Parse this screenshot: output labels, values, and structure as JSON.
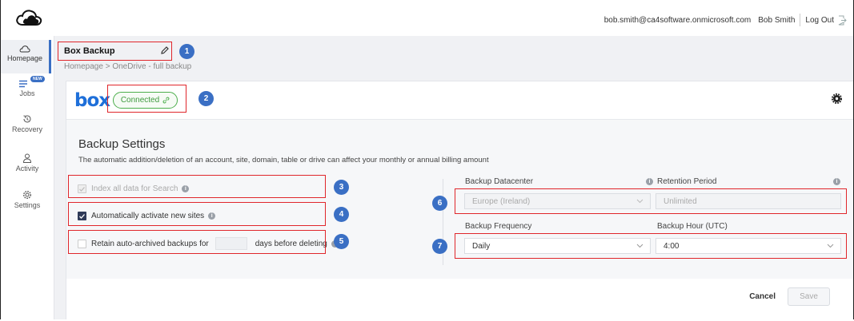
{
  "topbar": {
    "email": "bob.smith@ca4software.onmicrosoft.com",
    "user_name": "Bob Smith",
    "logout_label": "Log Out"
  },
  "sidebar": {
    "items": [
      {
        "label": "Homepage",
        "icon": "cloud-icon",
        "active": true
      },
      {
        "label": "Jobs",
        "icon": "list-icon",
        "badge": "NEW"
      },
      {
        "label": "Recovery",
        "icon": "restore-icon"
      },
      {
        "label": "Activity",
        "icon": "person-icon"
      },
      {
        "label": "Settings",
        "icon": "gear-icon"
      }
    ]
  },
  "header": {
    "title": "Box Backup",
    "breadcrumb": "Homepage > OneDrive - full backup"
  },
  "card": {
    "service_logo": "box",
    "connection_status": "Connected",
    "settings_title": "Backup Settings",
    "settings_description": "The automatic addition/deletion of an account, site, domain, table or drive can affect your monthly or annual billing amount",
    "options": {
      "index_search": {
        "label": "Index all data for Search",
        "checked": true,
        "disabled": true
      },
      "auto_activate": {
        "label": "Automatically activate new sites",
        "checked": true
      },
      "retain": {
        "label_before": "Retain auto-archived backups for",
        "label_after": "days before deleting",
        "checked": false,
        "days_value": ""
      }
    },
    "fields": {
      "datacenter": {
        "label": "Backup Datacenter",
        "value": "Europe (Ireland)",
        "disabled": true
      },
      "retention": {
        "label": "Retention Period",
        "value": "Unlimited",
        "disabled": true
      },
      "frequency": {
        "label": "Backup Frequency",
        "value": "Daily"
      },
      "hour": {
        "label": "Backup Hour (UTC)",
        "value": "4:00"
      }
    },
    "footer": {
      "cancel_label": "Cancel",
      "save_label": "Save"
    }
  },
  "annotations": [
    "1",
    "2",
    "3",
    "4",
    "5",
    "6",
    "7"
  ],
  "colors": {
    "accent": "#3a6fc4",
    "annotation_box": "#e0262b",
    "connected": "#4cae4c",
    "box_brand": "#1e6fd9"
  }
}
